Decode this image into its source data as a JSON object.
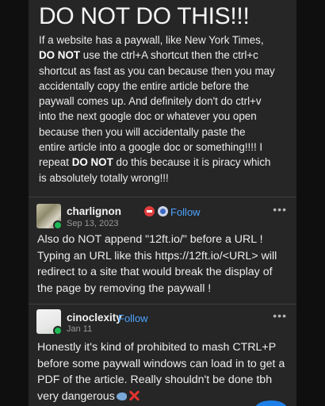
{
  "post": {
    "headline": "DO NOT DO THIS!!!",
    "lines": [
      {
        "pre": "If a website has a paywall, like New York Times,",
        "bold": "",
        "post": ""
      },
      {
        "pre": "",
        "bold": "DO NOT",
        "post": " use the ctrl+A shortcut then the ctrl+c"
      },
      {
        "pre": "shortcut as fast as you can because then you may",
        "bold": "",
        "post": ""
      },
      {
        "pre": "accidentally copy the entire article before the",
        "bold": "",
        "post": ""
      },
      {
        "pre": "paywall comes up. And definitely don't do ctrl+v",
        "bold": "",
        "post": ""
      },
      {
        "pre": "into the next google doc or whatever you open",
        "bold": "",
        "post": ""
      },
      {
        "pre": "because then you will accidentally paste the",
        "bold": "",
        "post": ""
      },
      {
        "pre": "entire article into a google doc or something!!!! I",
        "bold": "",
        "post": ""
      },
      {
        "pre": "repeat ",
        "bold": "DO NOT",
        "post": " do this because it is piracy which"
      },
      {
        "pre": "is absolutely totally wrong!!!",
        "bold": "",
        "post": ""
      }
    ]
  },
  "replies": [
    {
      "username": "charlignon",
      "date": "Sep 13, 2023",
      "follow_label": "Follow",
      "icons": [
        "red-badge-icon",
        "blue-badge-icon"
      ],
      "lines": [
        "Also do NOT append \"12ft.io/\" before a URL !",
        "Typing an URL like this https://12ft.io/<URL> will",
        "redirect to a site that would break the display of",
        "the page by removing the paywall !"
      ]
    },
    {
      "username": "cinoclexity",
      "date": "Jan 11",
      "follow_label": "Follow",
      "lines": [
        "Honestly it's kind of prohibited to mash CTRL+P",
        "before some paywall windows can load in to get a",
        "PDF of the article. Really shouldn't be done tbh",
        "very dangerous"
      ],
      "emojis": [
        "fish-emoji",
        "cross-mark-emoji"
      ]
    }
  ],
  "more_label": "•••",
  "colors": {
    "background": "#0f0f0f",
    "card": "#262626",
    "follow": "#4ba3ff",
    "text": "#ededed",
    "muted": "#9a9a9a"
  }
}
